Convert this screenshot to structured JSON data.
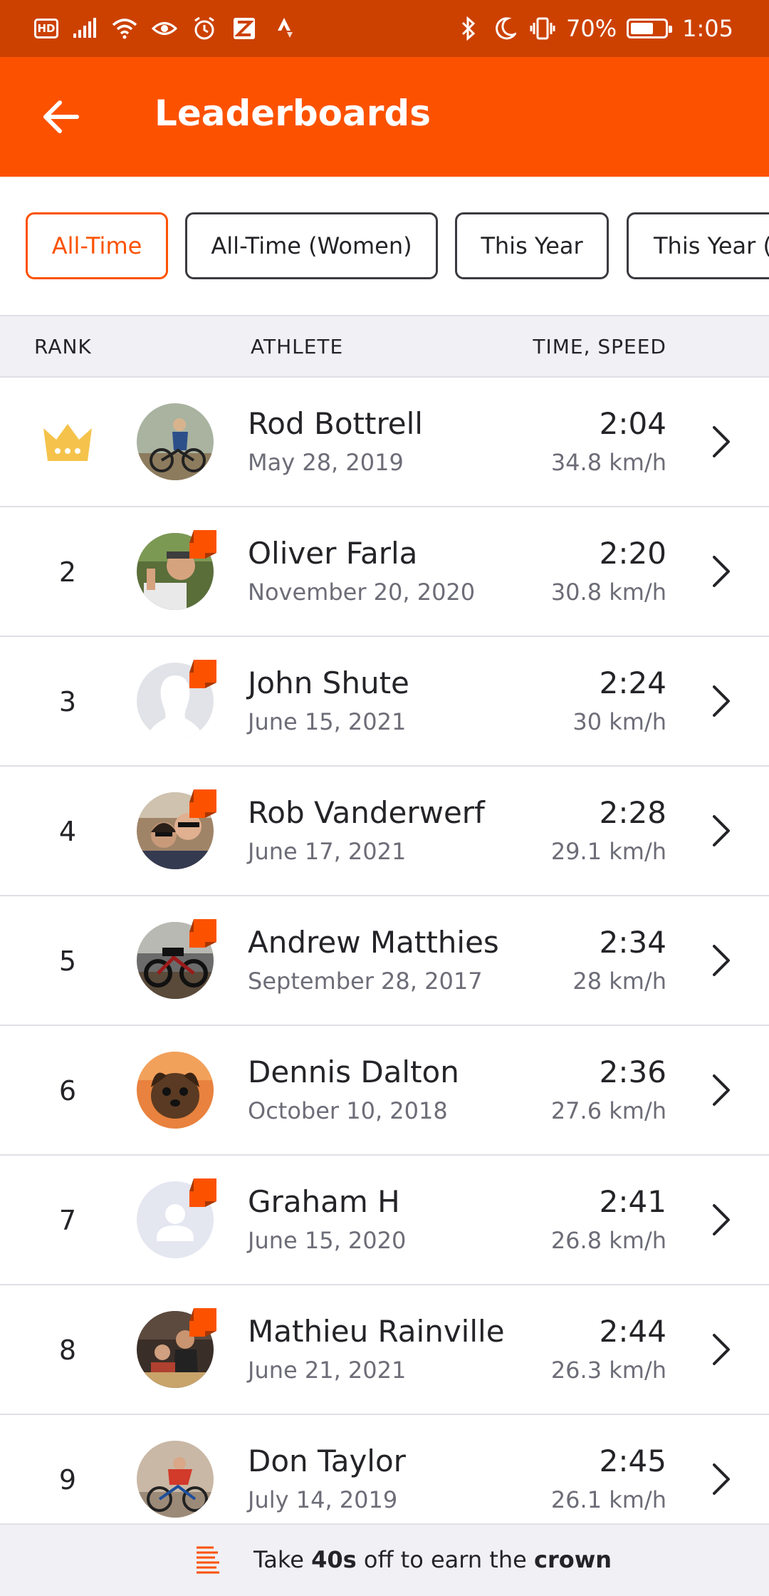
{
  "status_bar": {
    "battery_percent": "70%",
    "battery_level": 0.7,
    "time": "1:05",
    "hd_label": "HD"
  },
  "app_bar": {
    "title": "Leaderboards"
  },
  "filters": [
    {
      "label": "All-Time",
      "active": true
    },
    {
      "label": "All-Time (Women)",
      "active": false
    },
    {
      "label": "This Year",
      "active": false
    },
    {
      "label": "This Year (",
      "active": false
    }
  ],
  "columns": {
    "rank": "RANK",
    "athlete": "ATHLETE",
    "time_speed": "TIME, SPEED"
  },
  "entries": [
    {
      "rank": "",
      "crown": true,
      "name": "Rod Bottrell",
      "date": "May 28, 2019",
      "time": "2:04",
      "speed": "34.8 km/h",
      "badge": false,
      "avatar": "photo-cyclist"
    },
    {
      "rank": "2",
      "name": "Oliver Farla",
      "date": "November 20, 2020",
      "time": "2:20",
      "speed": "30.8 km/h",
      "badge": true,
      "avatar": "photo-man"
    },
    {
      "rank": "3",
      "name": "John Shute",
      "date": "June 15, 2021",
      "time": "2:24",
      "speed": "30 km/h",
      "badge": true,
      "avatar": "silhouette"
    },
    {
      "rank": "4",
      "name": "Rob Vanderwerf",
      "date": "June 17, 2021",
      "time": "2:28",
      "speed": "29.1 km/h",
      "badge": true,
      "avatar": "photo-couple"
    },
    {
      "rank": "5",
      "name": "Andrew Matthies",
      "date": "September 28, 2017",
      "time": "2:34",
      "speed": "28 km/h",
      "badge": true,
      "avatar": "photo-bike"
    },
    {
      "rank": "6",
      "name": "Dennis Dalton",
      "date": "October 10, 2018",
      "time": "2:36",
      "speed": "27.6 km/h",
      "badge": false,
      "avatar": "photo-dog"
    },
    {
      "rank": "7",
      "name": "Graham H",
      "date": "June 15, 2020",
      "time": "2:41",
      "speed": "26.8 km/h",
      "badge": true,
      "avatar": "default-person"
    },
    {
      "rank": "8",
      "name": "Mathieu Rainville",
      "date": "June 21, 2021",
      "time": "2:44",
      "speed": "26.3 km/h",
      "badge": true,
      "avatar": "photo-group"
    },
    {
      "rank": "9",
      "name": "Don Taylor",
      "date": "July 14, 2019",
      "time": "2:45",
      "speed": "26.1 km/h",
      "badge": false,
      "avatar": "photo-racer"
    }
  ],
  "footer": {
    "prefix": "Take ",
    "bold_time": "40s",
    "middle": " off to earn the ",
    "bold_crown": "crown"
  },
  "colors": {
    "brand": "#fc5200",
    "status_bar": "#cc4100",
    "crown": "#f5c34b"
  },
  "icons": {
    "back": "arrow-left-icon",
    "crown": "crown-icon",
    "chevron": "chevron-right-icon",
    "subscriber_badge": "subscriber-badge-icon",
    "footer": "segment-icon"
  }
}
